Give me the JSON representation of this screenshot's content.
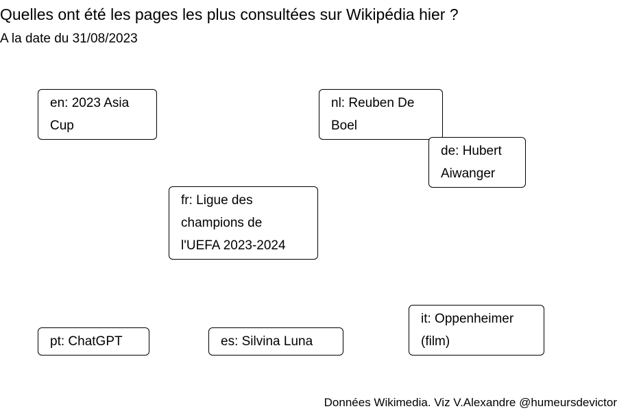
{
  "header": {
    "title": "Quelles ont été les pages les plus consultées sur Wikipédia hier ?",
    "subtitle": "A la date du 31/08/2023"
  },
  "caption": "Données Wikimedia. Viz V.Alexandre @humeursdevictor",
  "chart_data": {
    "type": "text-labels",
    "items": [
      {
        "lang": "en",
        "lines": [
          "en: 2023 Asia",
          "Cup"
        ]
      },
      {
        "lang": "nl",
        "lines": [
          "nl: Reuben De",
          "Boel"
        ]
      },
      {
        "lang": "de",
        "lines": [
          "de: Hubert",
          "Aiwanger"
        ]
      },
      {
        "lang": "fr",
        "lines": [
          "fr: Ligue des",
          "champions de",
          "l'UEFA 2023-2024"
        ]
      },
      {
        "lang": "it",
        "lines": [
          "it: Oppenheimer",
          "(film)"
        ]
      },
      {
        "lang": "pt",
        "lines": [
          "pt: ChatGPT"
        ]
      },
      {
        "lang": "es",
        "lines": [
          "es: Silvina Luna"
        ]
      }
    ]
  }
}
